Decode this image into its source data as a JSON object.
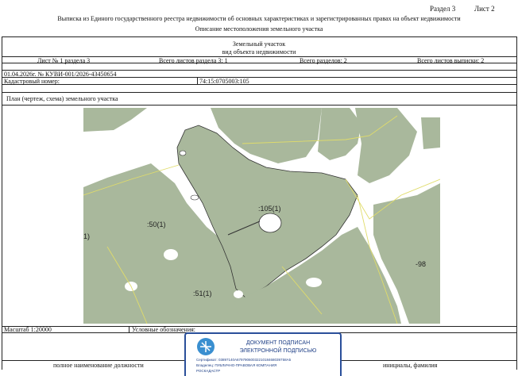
{
  "header": {
    "section_sheet": "Раздел 3",
    "sheet_label": "Лист 2",
    "title_line1": "Выписка из Единого государственного реестра недвижимости об основных характеристиках и зарегистрированных правах на объект недвижимости",
    "title_line2": "Описание местоположения земельного участка"
  },
  "table": {
    "object_type": "Земельный участок",
    "object_type_caption": "вид объекта недвижимости",
    "sheet_no": "Лист № 1 раздела 3",
    "total_sheets_section": "Всего листов раздела 3: 1",
    "total_sections": "Всего разделов: 2",
    "total_sheets_extract": "Всего листов выписки: 2",
    "date_number": "01.04.2026г. № КУВИ-001/2026-43450654",
    "cadastral_label": "Кадастровый номер:",
    "cadastral_value": "74:15:0705003:105",
    "plan_label": "План (чертеж, схема) земельного участка"
  },
  "map": {
    "labels": [
      ":105(1)",
      ":50(1)",
      ":51(1)",
      "-98",
      "1)"
    ],
    "colors": {
      "green": "#a9b89c",
      "boundary": "#e0dc6a",
      "outline": "#333333"
    }
  },
  "footer": {
    "scale": "Масштаб 1:20000",
    "legend": "Условные обозначения:",
    "position_caption": "полное наименование должности",
    "name_caption": "инициалы, фамилия"
  },
  "stamp": {
    "line1": "ДОКУМЕНТ ПОДПИСАН",
    "line2": "ЭЛЕКТРОННОЙ ПОДПИСЬЮ",
    "cert": "Сертификат: 03897140A6797906003221018468039758A5",
    "owner": "Владелец: ПУБЛИЧНО-ПРАВОВАЯ КОМПАНИЯ",
    "owner2": "РОСКАДАСТР"
  }
}
